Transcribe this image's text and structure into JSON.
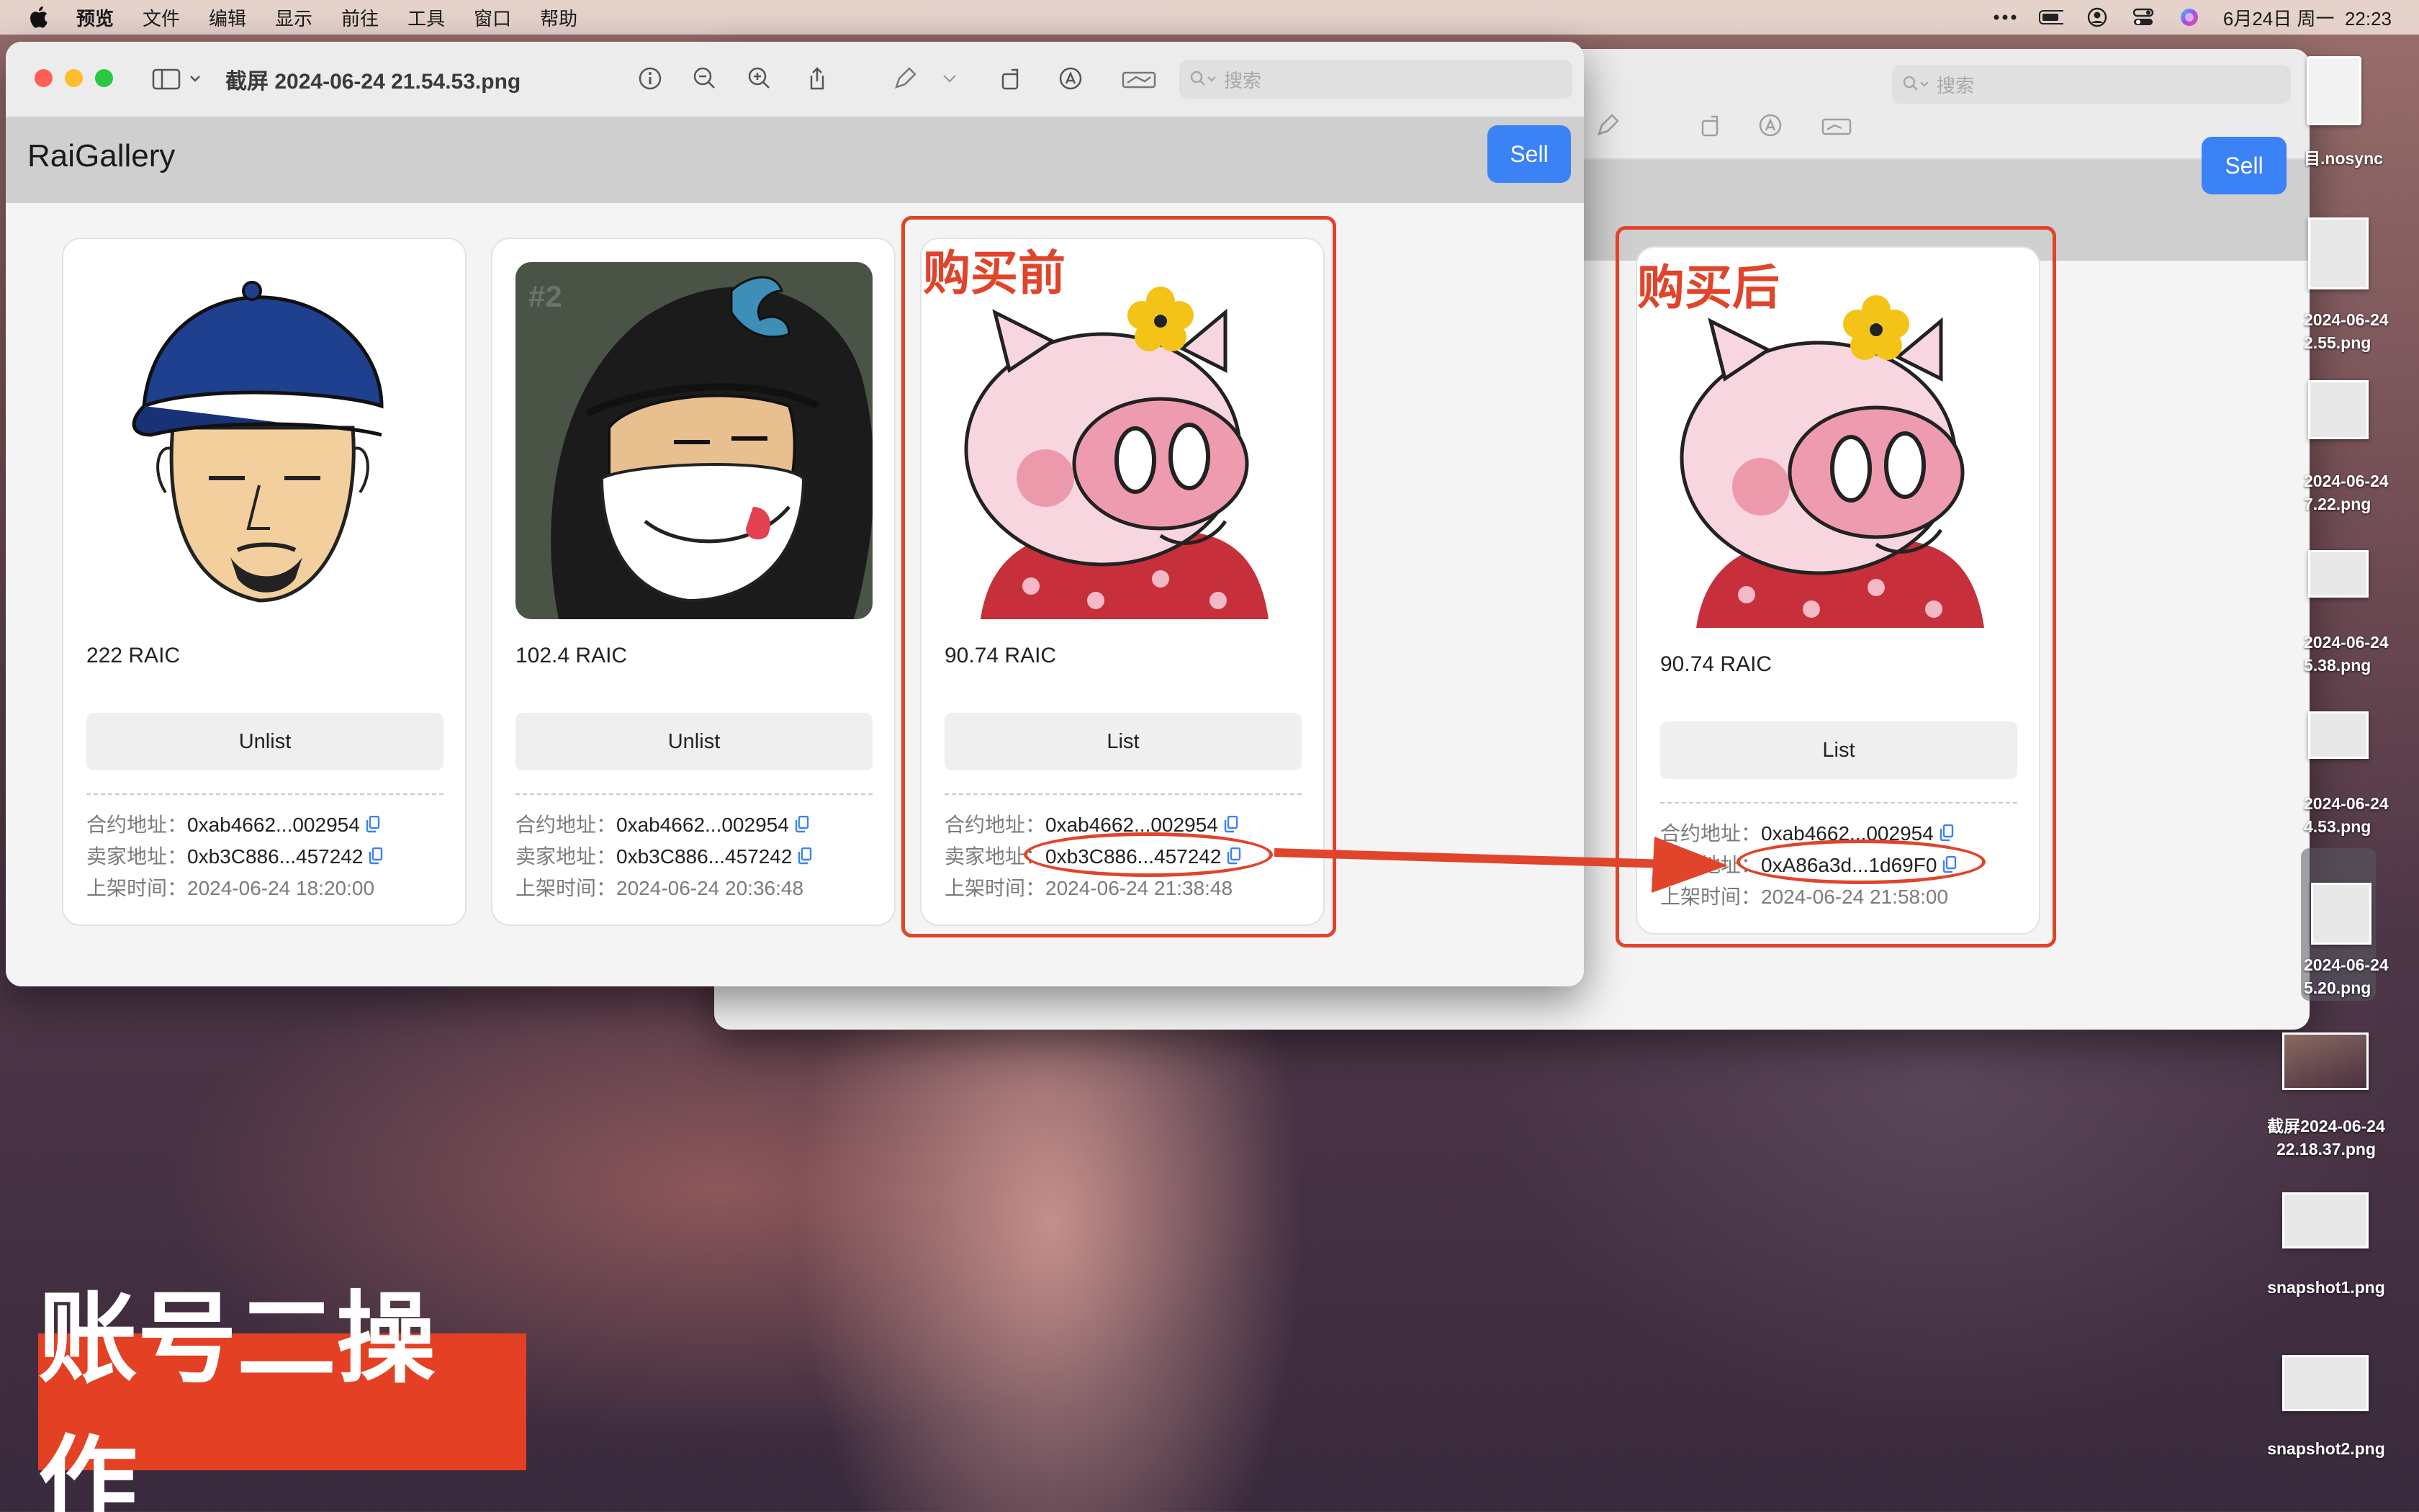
{
  "menubar": {
    "app": "预览",
    "items": [
      "文件",
      "编辑",
      "显示",
      "前往",
      "工具",
      "窗口",
      "帮助"
    ],
    "datetime": "6月24日 周一  22:23"
  },
  "front_window": {
    "title": "截屏 2024-06-24 21.54.53.png",
    "search_placeholder": "搜索",
    "app_title": "RaiGallery",
    "sell_label": "Sell",
    "cards": [
      {
        "price": "222 RAIC",
        "action": "Unlist",
        "contract_label": "合约地址：",
        "contract": "0xab4662...002954",
        "seller_label": "卖家地址：",
        "seller": "0xb3C886...457242",
        "time_label": "上架时间：",
        "time": "2024-06-24 18:20:00"
      },
      {
        "price": "102.4 RAIC",
        "action": "Unlist",
        "contract_label": "合约地址：",
        "contract": "0xab4662...002954",
        "seller_label": "卖家地址：",
        "seller": "0xb3C886...457242",
        "time_label": "上架时间：",
        "time": "2024-06-24 20:36:48"
      },
      {
        "price": "90.74 RAIC",
        "action": "List",
        "contract_label": "合约地址：",
        "contract": "0xab4662...002954",
        "seller_label": "卖家地址：",
        "seller": "0xb3C886...457242",
        "time_label": "上架时间：",
        "time": "2024-06-24 21:38:48"
      }
    ],
    "nft2_badge": "#2"
  },
  "back_window": {
    "search_placeholder": "搜索",
    "sell_label": "Sell",
    "card": {
      "price": "90.74 RAIC",
      "action": "List",
      "contract_label": "合约地址：",
      "contract": "0xab4662...002954",
      "seller_label": "卖家地址：",
      "seller": "0xA86a3d...1d69F0",
      "time_label": "上架时间：",
      "time": "2024-06-24 21:58:00"
    }
  },
  "annotations": {
    "before": "购买前",
    "after": "购买后",
    "stamp": "账号二操作",
    "color": "#e0442a"
  },
  "desktop": {
    "files": [
      {
        "name": "目.nosync"
      },
      {
        "name": "2024-06-24\n2.55.png"
      },
      {
        "name": "2024-06-24\n7.22.png"
      },
      {
        "name": "2024-06-24\n5.38.png"
      },
      {
        "name": "2024-06-24\n4.53.png"
      },
      {
        "name": "2024-06-24\n5.20.png"
      },
      {
        "name": "截屏2024-06-24\n22.18.37.png"
      },
      {
        "name": "snapshot1.png"
      },
      {
        "name": "snapshot2.png"
      }
    ]
  }
}
